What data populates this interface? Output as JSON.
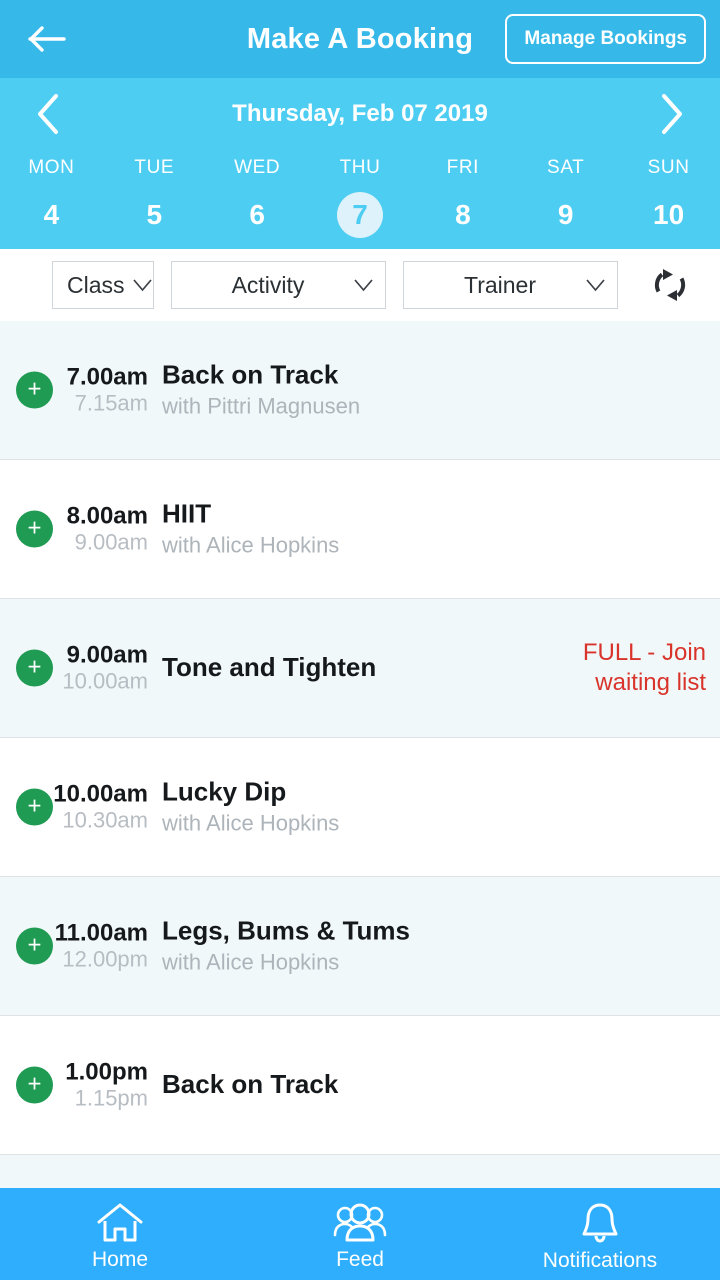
{
  "appbar": {
    "back_icon": "arrow-left-icon",
    "title": "Make A Booking",
    "manage_label": "Manage Bookings"
  },
  "datestrip": {
    "prev_icon": "chevron-left-icon",
    "next_icon": "chevron-right-icon",
    "selected_date_label": "Thursday, Feb 07 2019",
    "days": [
      {
        "name": "MON",
        "num": "4",
        "selected": false
      },
      {
        "name": "TUE",
        "num": "5",
        "selected": false
      },
      {
        "name": "WED",
        "num": "6",
        "selected": false
      },
      {
        "name": "THU",
        "num": "7",
        "selected": true
      },
      {
        "name": "FRI",
        "num": "8",
        "selected": false
      },
      {
        "name": "SAT",
        "num": "9",
        "selected": false
      },
      {
        "name": "SUN",
        "num": "10",
        "selected": false
      }
    ]
  },
  "filters": {
    "class_label": "Class",
    "activity_label": "Activity",
    "trainer_label": "Trainer",
    "refresh_icon": "refresh-icon"
  },
  "classes": [
    {
      "start": "7.00am",
      "end": "7.15am",
      "title": "Back on Track",
      "trainer": "with Pittri Magnusen",
      "status": "",
      "add_label": "+"
    },
    {
      "start": "8.00am",
      "end": "9.00am",
      "title": "HIIT",
      "trainer": "with Alice Hopkins",
      "status": "",
      "add_label": "+"
    },
    {
      "start": "9.00am",
      "end": "10.00am",
      "title": "Tone and Tighten",
      "trainer": "",
      "status": "FULL - Join waiting list",
      "add_label": "+"
    },
    {
      "start": "10.00am",
      "end": "10.30am",
      "title": "Lucky Dip",
      "trainer": "with Alice Hopkins",
      "status": "",
      "add_label": "+"
    },
    {
      "start": "11.00am",
      "end": "12.00pm",
      "title": "Legs, Bums & Tums",
      "trainer": "with Alice Hopkins",
      "status": "",
      "add_label": "+"
    },
    {
      "start": "1.00pm",
      "end": "1.15pm",
      "title": "Back on Track",
      "trainer": "",
      "status": "",
      "add_label": "+"
    }
  ],
  "bottomnav": [
    {
      "label": "Home",
      "icon": "home-icon"
    },
    {
      "label": "Feed",
      "icon": "people-icon"
    },
    {
      "label": "Notifications",
      "icon": "bell-icon"
    }
  ],
  "colors": {
    "appbar": "#36b9e9",
    "datestrip": "#4ecdf2",
    "bottomnav": "#2eaefc",
    "accent_green": "#1f9b53",
    "status_red": "#d9342b",
    "row_alt": "#f1f8fa"
  }
}
